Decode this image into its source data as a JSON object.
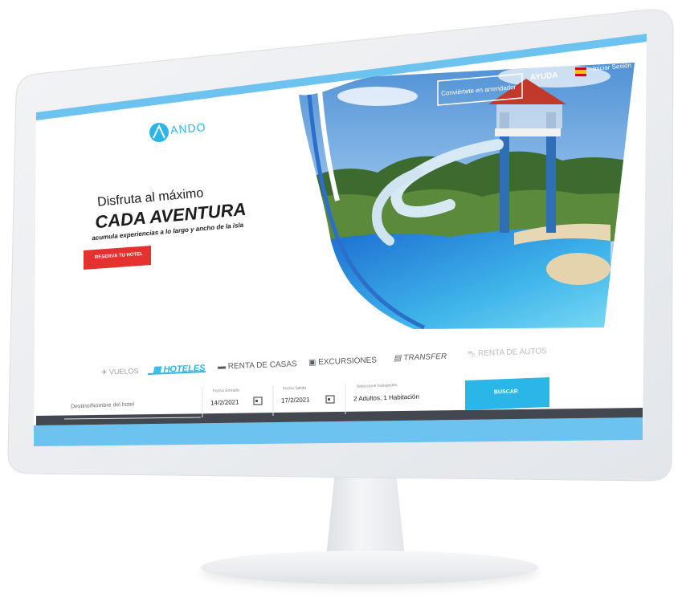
{
  "logo": {
    "text": "ANDO"
  },
  "header": {
    "host_cta": "Conviértete en arrendador",
    "help": "AYUDA",
    "login": "Iniciar Sesión"
  },
  "hero": {
    "line1": "Disfruta al máximo",
    "line2": "CADA AVENTURA",
    "line3": "acumula experiencias a lo largo y ancho de la isla",
    "cta": "RESERVA TU HOTEL"
  },
  "tabs": [
    {
      "label": "VUELOS",
      "icon": "plane-icon",
      "active": false
    },
    {
      "label": "HOTELES",
      "icon": "hotel-icon",
      "active": true
    },
    {
      "label": "RENTA DE CASAS",
      "icon": "bed-icon",
      "active": false
    },
    {
      "label": "EXCURSIONES",
      "icon": "ticket-icon",
      "active": false
    },
    {
      "label": "TRANSFER",
      "icon": "bus-icon",
      "active": false
    },
    {
      "label": "RENTA DE AUTOS",
      "icon": "car-icon",
      "active": false
    }
  ],
  "search": {
    "destination_placeholder": "Destino/Nombre del hotel",
    "checkin_label": "Fecha Entrada",
    "checkin_value": "14/2/2021",
    "checkout_label": "Fecha Salida",
    "checkout_value": "17/2/2021",
    "guests_label": "Seleccione huéspedes",
    "guests_value": "2 Adultos, 1 Habitación",
    "button": "BUSCAR"
  },
  "colors": {
    "accent": "#2bb6e8",
    "cta_red": "#e5312f",
    "bar_blue": "#6cc3f0",
    "text_dark": "#1d1d1d"
  }
}
